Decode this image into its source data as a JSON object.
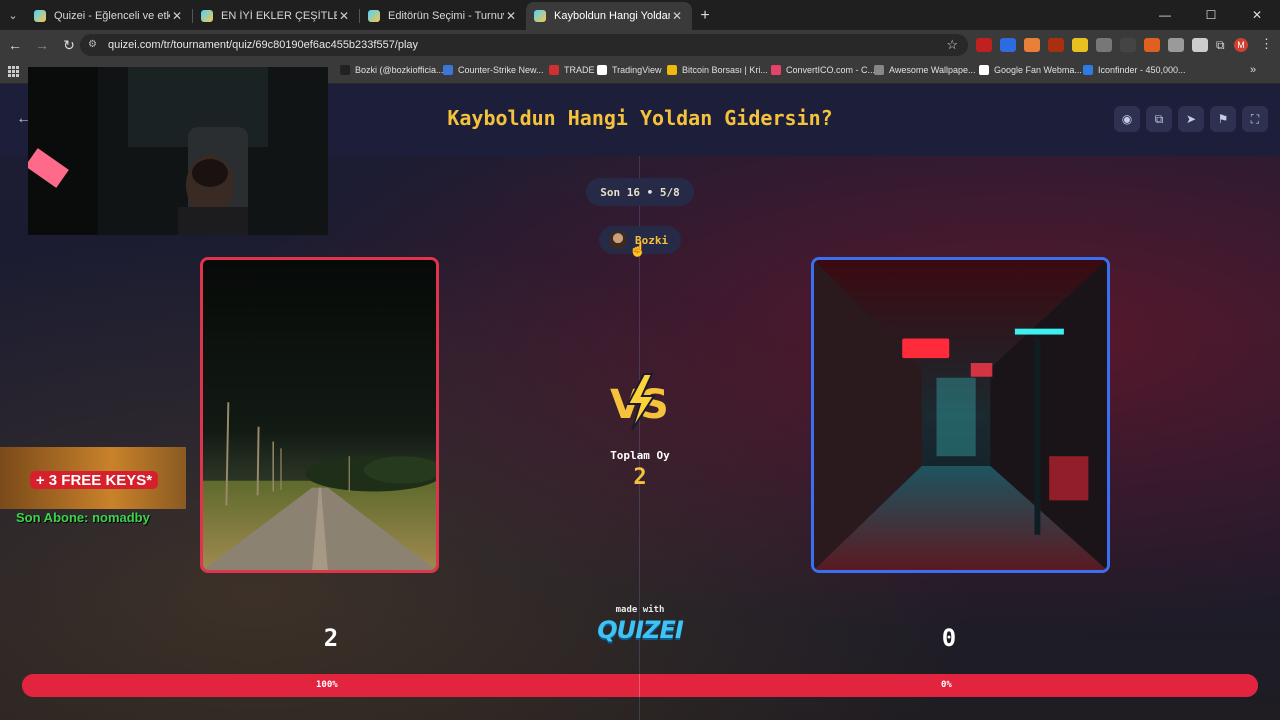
{
  "browser": {
    "tabs": [
      {
        "title": "Quizei - Eğlenceli ve etkileşimli",
        "active": false
      },
      {
        "title": "EN İYİ EKLER ÇEŞİTLERİ - Tier L",
        "active": false
      },
      {
        "title": "Editörün Seçimi - Turnuva - Q",
        "active": false
      },
      {
        "title": "Kayboldun Hangi Yoldan Giders",
        "active": true
      }
    ],
    "new_tab": "+",
    "url": "quizei.com/tr/tournament/quiz/69c80190ef6ac455b233f557/play",
    "profile_initial": "M",
    "bookmarks": [
      "Bozki (@bozkiofficia...",
      "Counter-Strike New...",
      "TRADE",
      "TradingView",
      "Bitcoin Borsası | Kri...",
      "ConvertICO.com - C...",
      "Awesome Wallpape...",
      "Google Fan Webma...",
      "Iconfinder - 450,000..."
    ],
    "bookmark_colors": [
      "#222222",
      "#3b78d8",
      "#d23030",
      "#ffffff",
      "#f0b90b",
      "#e8416a",
      "#888888",
      "#ffffff",
      "#2f7be6"
    ],
    "extension_colors": [
      "#c02020",
      "#2d6be0",
      "#e8803a",
      "#a83010",
      "#e8c020",
      "#777777",
      "#444444",
      "#e06020",
      "#9a9a9a",
      "#cccccc"
    ]
  },
  "quiz": {
    "title": "Kayboldun Hangi Yoldan Gidersin?",
    "round": "Son 16 • 5/8",
    "author": "Bozki",
    "total_label": "Toplam Oy",
    "total_votes": "2",
    "left": {
      "score": "2",
      "percent": "100%",
      "percent_value": 100
    },
    "right": {
      "score": "0",
      "percent": "0%",
      "percent_value": 0
    },
    "made_with": "made with",
    "brand": "QUIZEI",
    "colors": {
      "accent": "#f5c33b",
      "left_border": "#e0344c",
      "right_border": "#3b6ff0",
      "progress": "#e3243f",
      "brand": "#3fc3f4"
    }
  },
  "overlay": {
    "keys_text": "+ 3 FREE KEYS*",
    "sub_text": "Son Abone: nomadby"
  }
}
